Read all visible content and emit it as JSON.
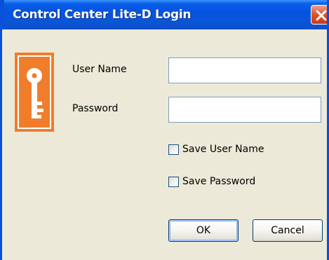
{
  "window": {
    "title": "Control Center Lite-D Login"
  },
  "icons": {
    "key": "key-icon",
    "close": "close-icon",
    "key_color": "#f07d2b"
  },
  "form": {
    "username_label": "User Name",
    "username_value": "",
    "password_label": "Password",
    "password_value": "",
    "save_username_label": "Save User Name",
    "save_username_checked": false,
    "save_password_label": "Save Password",
    "save_password_checked": false
  },
  "buttons": {
    "ok_label": "OK",
    "cancel_label": "Cancel"
  }
}
